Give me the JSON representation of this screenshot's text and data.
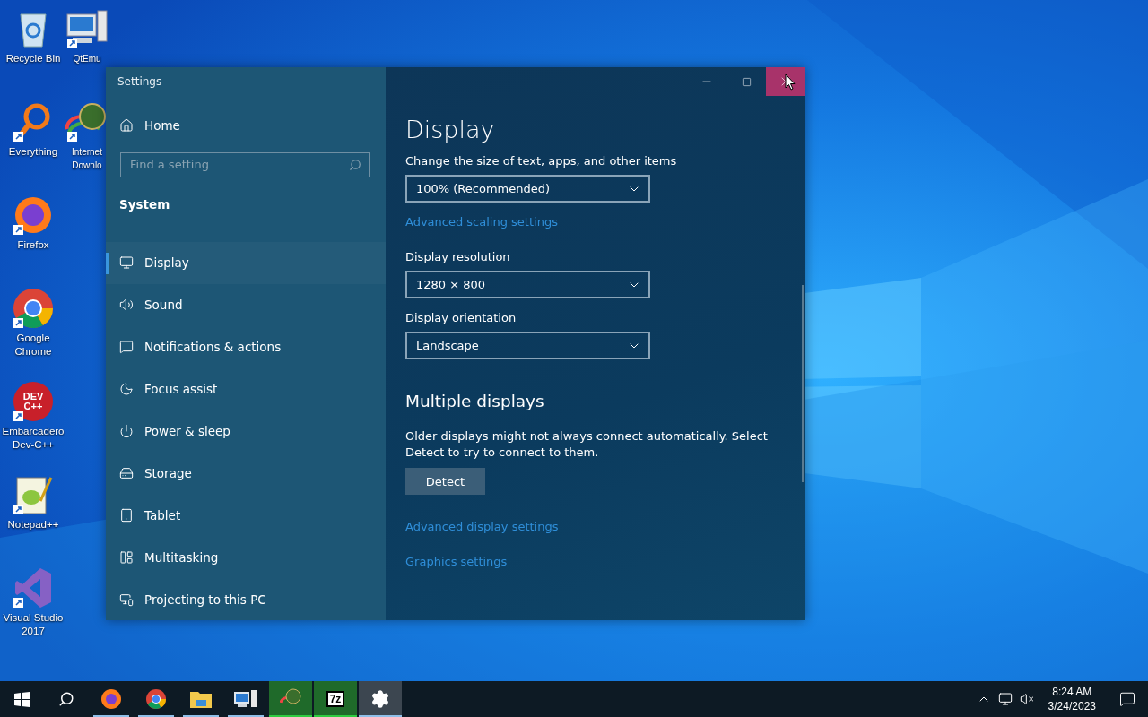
{
  "desktop_icons": [
    {
      "label": "Recycle Bin",
      "shortcut": false
    },
    {
      "label": "Everything",
      "shortcut": true
    },
    {
      "label": "Firefox",
      "shortcut": true
    },
    {
      "label": "Google Chrome",
      "shortcut": true
    },
    {
      "label": "Embarcadero Dev-C++",
      "shortcut": true,
      "glyph": "DEV C++"
    },
    {
      "label": "Notepad++",
      "shortcut": true
    },
    {
      "label": "Visual Studio 2017",
      "shortcut": true
    },
    {
      "label": "QtEmu",
      "shortcut": true
    },
    {
      "label": "Internet Downlo",
      "shortcut": true
    }
  ],
  "window": {
    "title": "Settings",
    "controls": [
      {
        "kind": "minimize",
        "hovered": false
      },
      {
        "kind": "maximize",
        "hovered": false
      },
      {
        "kind": "close",
        "hovered": true
      }
    ],
    "sidebar": {
      "home": "Home",
      "search": {
        "placeholder": "Find a setting"
      },
      "section": "System",
      "items": [
        {
          "label": "Display",
          "selected": true
        },
        {
          "label": "Sound",
          "selected": false
        },
        {
          "label": "Notifications & actions",
          "selected": false
        },
        {
          "label": "Focus assist",
          "selected": false
        },
        {
          "label": "Power & sleep",
          "selected": false
        },
        {
          "label": "Storage",
          "selected": false
        },
        {
          "label": "Tablet",
          "selected": false
        },
        {
          "label": "Multitasking",
          "selected": false
        },
        {
          "label": "Projecting to this PC",
          "selected": false
        }
      ]
    },
    "content": {
      "heading": "Display",
      "blocks": [
        {
          "kind": "dropdown",
          "label": "Change the size of text, apps, and other items",
          "value": "100% (Recommended)"
        },
        {
          "kind": "link",
          "text": "Advanced scaling settings"
        },
        {
          "kind": "dropdown",
          "label": "Display resolution",
          "value": "1280 × 800"
        },
        {
          "kind": "dropdown",
          "label": "Display orientation",
          "value": "Landscape"
        },
        {
          "kind": "heading",
          "text": "Multiple displays"
        },
        {
          "kind": "paragraph",
          "text": "Older displays might not always connect automatically. Select Detect to try to connect to them."
        },
        {
          "kind": "button",
          "text": "Detect"
        },
        {
          "kind": "link",
          "text": "Advanced display settings"
        },
        {
          "kind": "link",
          "text": "Graphics settings"
        }
      ]
    }
  },
  "taskbar": {
    "items": [
      {
        "kind": "start",
        "open": false,
        "flashing": false,
        "active": false
      },
      {
        "kind": "search",
        "open": false,
        "flashing": false,
        "active": false
      },
      {
        "kind": "firefox",
        "open": true,
        "flashing": false,
        "active": false
      },
      {
        "kind": "chrome",
        "open": true,
        "flashing": false,
        "active": false
      },
      {
        "kind": "explorer",
        "open": true,
        "flashing": false,
        "active": false
      },
      {
        "kind": "computer",
        "open": true,
        "flashing": false,
        "active": false
      },
      {
        "kind": "downloader",
        "open": true,
        "flashing": true,
        "active": false
      },
      {
        "kind": "archiver",
        "open": true,
        "flashing": true,
        "active": false,
        "glyph": "7z"
      },
      {
        "kind": "settings",
        "open": true,
        "flashing": false,
        "active": true
      }
    ],
    "clock": {
      "time": "8:24 AM",
      "date": "3/24/2023"
    }
  }
}
